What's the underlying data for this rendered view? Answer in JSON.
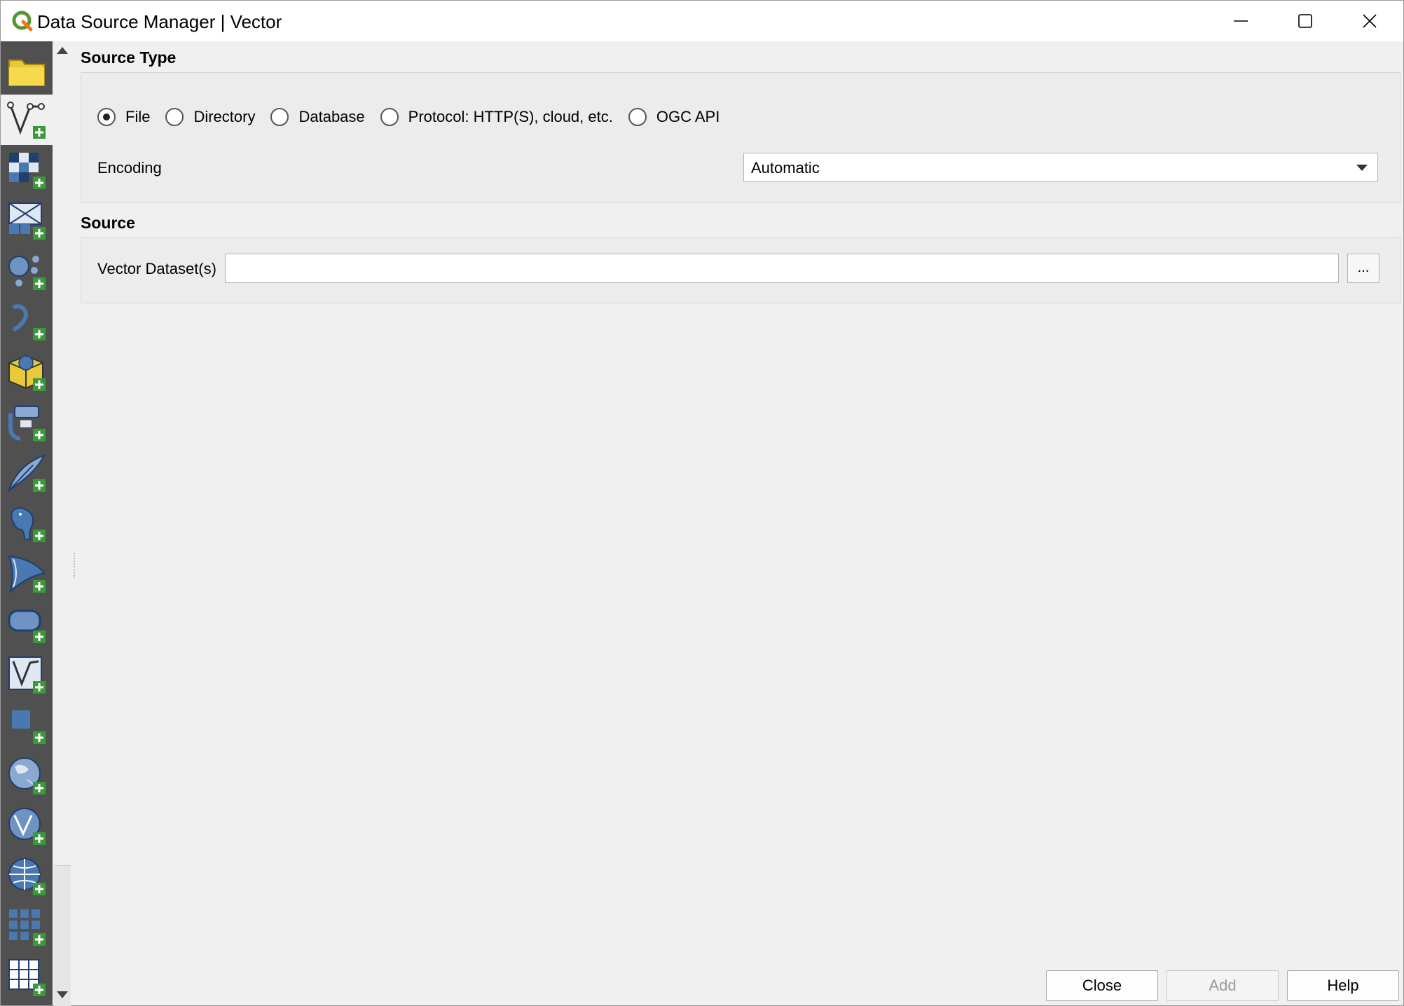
{
  "window": {
    "title": "Data Source Manager | Vector",
    "controls": {
      "minimize": "minimize",
      "maximize": "maximize",
      "close": "close"
    }
  },
  "sidebar": {
    "items": [
      {
        "icon": "browser-folder-icon",
        "active": false
      },
      {
        "icon": "vector-layer-icon",
        "active": true
      },
      {
        "icon": "raster-layer-icon",
        "active": false
      },
      {
        "icon": "mesh-layer-icon",
        "active": false
      },
      {
        "icon": "point-cloud-layer-icon",
        "active": false
      },
      {
        "icon": "delimited-text-icon",
        "active": false
      },
      {
        "icon": "geopackage-icon",
        "active": false
      },
      {
        "icon": "gps-icon",
        "active": false
      },
      {
        "icon": "spatialite-icon",
        "active": false
      },
      {
        "icon": "postgresql-icon",
        "active": false
      },
      {
        "icon": "mssql-icon",
        "active": false
      },
      {
        "icon": "oracle-icon",
        "active": false
      },
      {
        "icon": "virtual-layer-icon",
        "active": false
      },
      {
        "icon": "sap-hana-icon",
        "active": false
      },
      {
        "icon": "wms-wmts-icon",
        "active": false
      },
      {
        "icon": "wfs-ogc-api-icon",
        "active": false
      },
      {
        "icon": "wcs-icon",
        "active": false
      },
      {
        "icon": "xyz-tiles-icon",
        "active": false
      },
      {
        "icon": "vector-tiles-icon",
        "active": false
      }
    ]
  },
  "source_type": {
    "title": "Source Type",
    "options": [
      {
        "label": "File",
        "checked": true
      },
      {
        "label": "Directory",
        "checked": false
      },
      {
        "label": "Database",
        "checked": false
      },
      {
        "label": "Protocol: HTTP(S), cloud, etc.",
        "checked": false
      },
      {
        "label": "OGC API",
        "checked": false
      }
    ],
    "encoding_label": "Encoding",
    "encoding_value": "Automatic"
  },
  "source": {
    "title": "Source",
    "dataset_label": "Vector Dataset(s)",
    "dataset_value": "",
    "browse_label": "..."
  },
  "buttons": {
    "close": "Close",
    "add": "Add",
    "help": "Help"
  },
  "colors": {
    "sidebar_bg": "#505050",
    "dialog_bg": "#f0f0f0",
    "icon_blue": "#4a78b0",
    "plus_green": "#3a9a3a"
  }
}
